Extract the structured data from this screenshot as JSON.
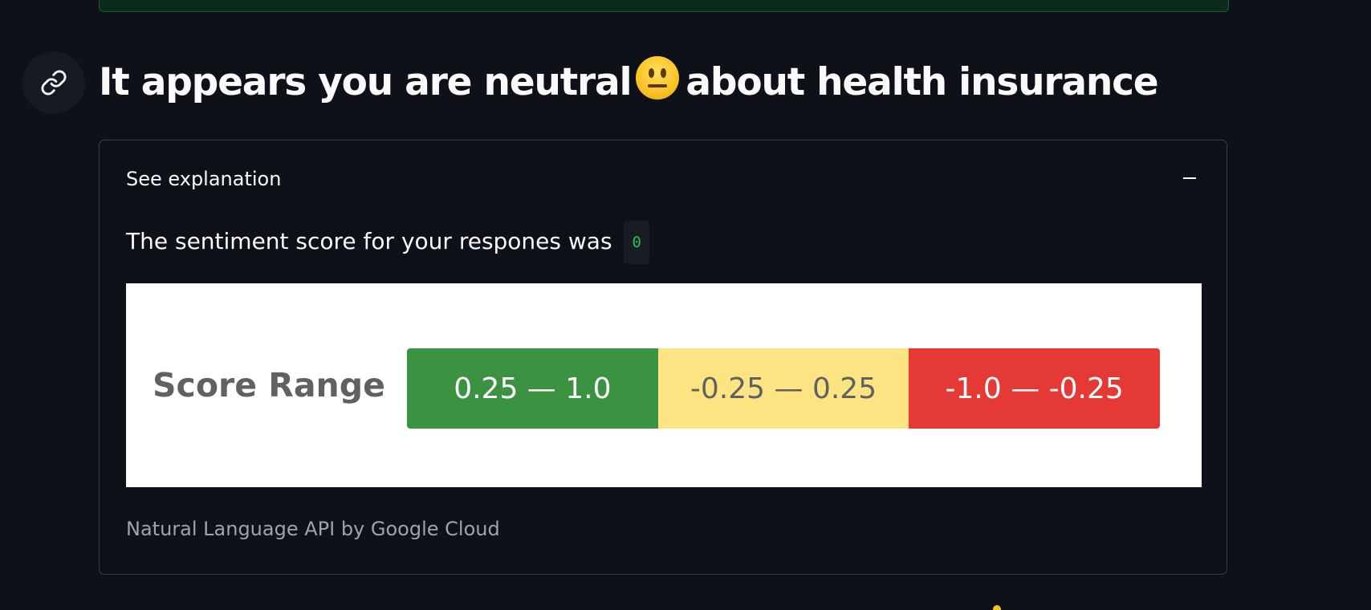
{
  "heading": {
    "before": "It appears you are neutral",
    "emoji": "neutral-face-emoji",
    "after": "about health insurance"
  },
  "expander": {
    "label": "See explanation",
    "collapse_icon": "minus"
  },
  "score_line": {
    "text": "The sentiment score for your respones was",
    "value": "0"
  },
  "score_range_image": {
    "title": "Score Range",
    "segments": [
      {
        "label": "0.25 — 1.0",
        "color": "#3b9241",
        "text_color": "#ffffff"
      },
      {
        "label": "-0.25 — 0.25",
        "color": "#fde482",
        "text_color": "#616161"
      },
      {
        "label": "-1.0 — -0.25",
        "color": "#e53935",
        "text_color": "#ffffff"
      }
    ]
  },
  "caption": "Natural Language API by Google Cloud",
  "colors": {
    "background": "#0e1117",
    "text": "#fafafa",
    "code": "#21c354",
    "border": "#3a3d47",
    "caption": "#9ea3ad"
  }
}
